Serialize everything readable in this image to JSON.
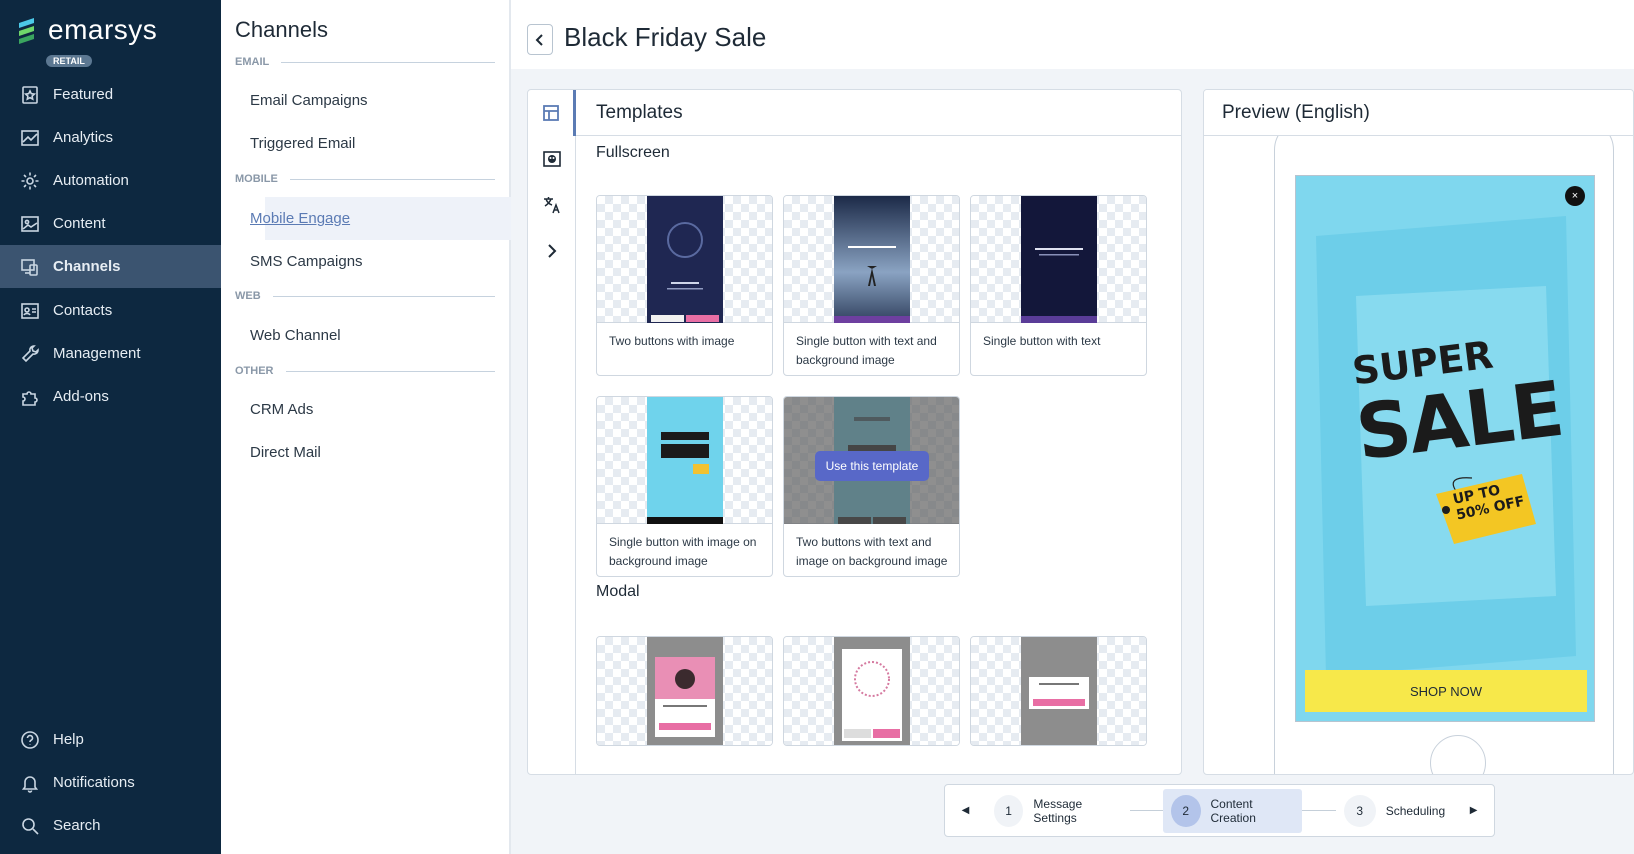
{
  "brand": {
    "name": "emarsys",
    "badge": "RETAIL"
  },
  "nav": {
    "items": [
      {
        "label": "Featured",
        "icon": "star-icon"
      },
      {
        "label": "Analytics",
        "icon": "analytics-icon"
      },
      {
        "label": "Automation",
        "icon": "gear-icon"
      },
      {
        "label": "Content",
        "icon": "content-icon"
      },
      {
        "label": "Channels",
        "icon": "channels-icon",
        "active": true
      },
      {
        "label": "Contacts",
        "icon": "contacts-icon"
      },
      {
        "label": "Management",
        "icon": "wrench-icon"
      },
      {
        "label": "Add-ons",
        "icon": "puzzle-icon"
      }
    ],
    "bottom": [
      {
        "label": "Help",
        "icon": "help-icon"
      },
      {
        "label": "Notifications",
        "icon": "bell-icon"
      },
      {
        "label": "Search",
        "icon": "search-icon"
      }
    ]
  },
  "channels_menu": {
    "title": "Channels",
    "sections": {
      "email": "EMAIL",
      "mobile": "MOBILE",
      "web": "WEB",
      "other": "OTHER"
    },
    "items": {
      "email_campaigns": "Email Campaigns",
      "triggered_email": "Triggered Email",
      "mobile_engage": "Mobile Engage",
      "sms_campaigns": "SMS Campaigns",
      "web_channel": "Web Channel",
      "crm_ads": "CRM Ads",
      "direct_mail": "Direct Mail"
    }
  },
  "page": {
    "title": "Black Friday Sale"
  },
  "templates": {
    "title": "Templates",
    "groups": {
      "fullscreen": "Fullscreen",
      "modal": "Modal"
    },
    "fullscreen": [
      "Two buttons with image",
      "Single button with text and background image",
      "Single button with text",
      "Single button with image on background image",
      "Two buttons with text and image on background image"
    ],
    "hover_action": "Use this template"
  },
  "preview": {
    "title": "Preview (English)",
    "headline_1": "SUPER",
    "headline_2": "SALE",
    "tag_text": "UP TO 50% OFF",
    "cta": "SHOP NOW",
    "close": "×"
  },
  "stepper": {
    "steps": [
      {
        "num": "1",
        "label": "Message Settings"
      },
      {
        "num": "2",
        "label": "Content Creation",
        "active": true
      },
      {
        "num": "3",
        "label": "Scheduling"
      }
    ]
  },
  "colors": {
    "nav_bg": "#0d2840",
    "nav_active": "#3b5470",
    "accent": "#5b7bb4",
    "cta": "#f7e84a",
    "preview_bg": "#7fd7ee"
  }
}
